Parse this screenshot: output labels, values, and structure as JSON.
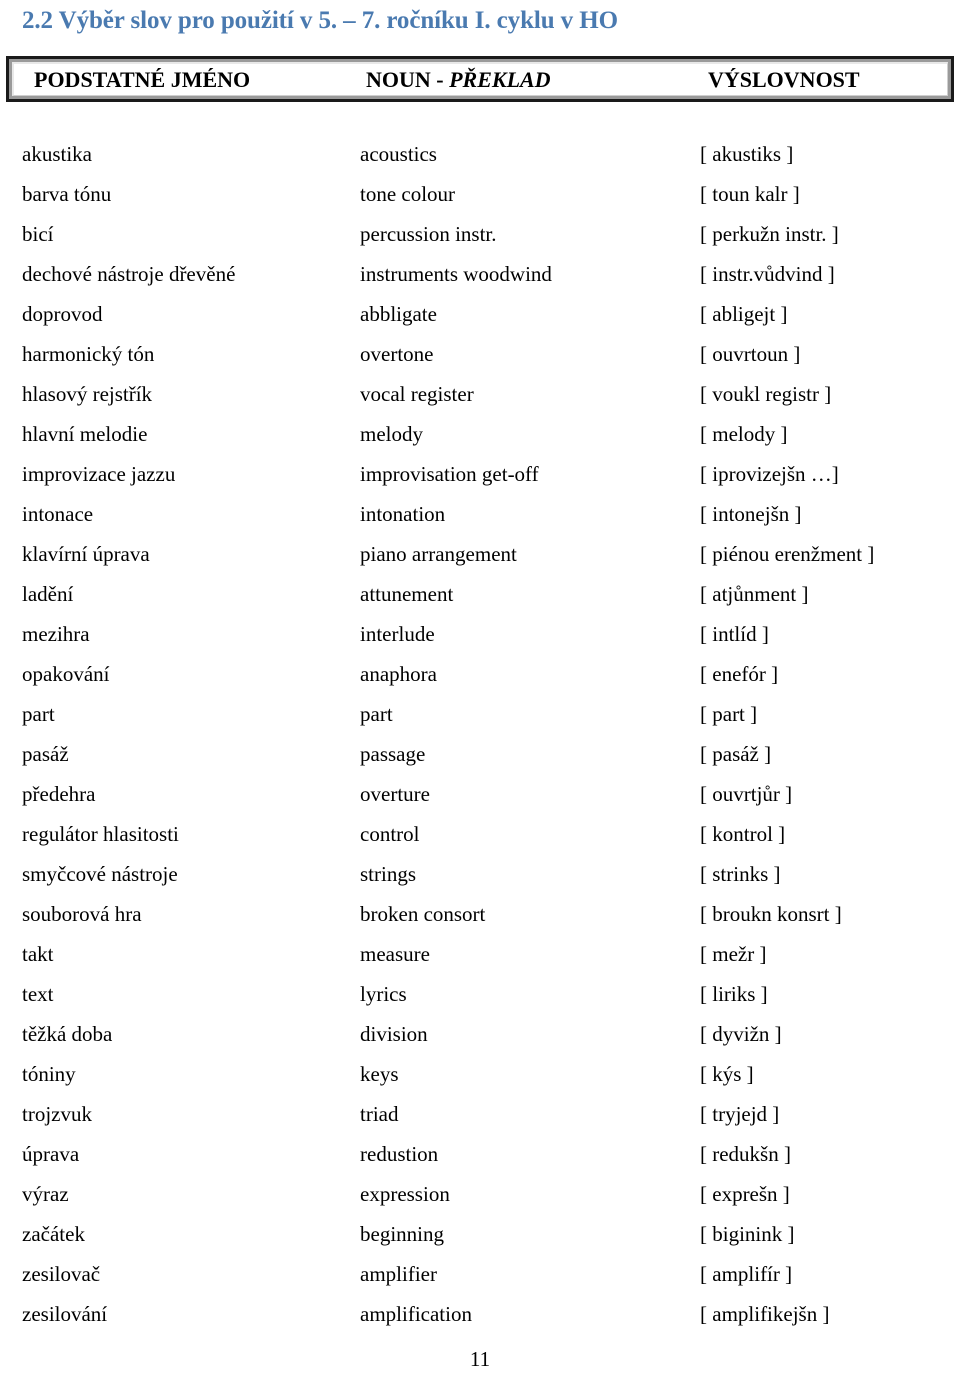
{
  "document": {
    "title": "2.2 Výběr slov pro použití v 5. – 7. ročníku I. cyklu v HO",
    "title_color": "#4a7ab0",
    "page_number": "11"
  },
  "table": {
    "headers": {
      "col1": "PODSTATNÉ JMÉNO",
      "col2_prefix": "NOUN - ",
      "col2_italic": "PŘEKLAD",
      "col3": "VÝSLOVNOST"
    },
    "rows": [
      {
        "cz": "akustika",
        "en": "acoustics",
        "pron": "[ akustiks ]"
      },
      {
        "cz": "barva tónu",
        "en": "tone colour",
        "pron": "[ toun kalr ]"
      },
      {
        "cz": "bicí",
        "en": "percussion instr.",
        "pron": "[ perkužn instr. ]"
      },
      {
        "cz": "dechové nástroje dřevěné",
        "en": "instruments woodwind",
        "pron": "[ instr.vůdvind ]"
      },
      {
        "cz": "doprovod",
        "en": "abbligate",
        "pron": "[ abligejt ]"
      },
      {
        "cz": "harmonický tón",
        "en": "overtone",
        "pron": "[ ouvrtoun ]"
      },
      {
        "cz": "hlasový rejstřík",
        "en": "vocal register",
        "pron": "[ voukl registr ]"
      },
      {
        "cz": "hlavní melodie",
        "en": "melody",
        "pron": "[ melody ]"
      },
      {
        "cz": "improvizace jazzu",
        "en": "improvisation get-off",
        "pron": "[ iprovizejšn …]"
      },
      {
        "cz": "intonace",
        "en": "intonation",
        "pron": "[ intonejšn ]"
      },
      {
        "cz": "klavírní úprava",
        "en": "piano arrangement",
        "pron": "[ piénou erenžment ]"
      },
      {
        "cz": "ladění",
        "en": "attunement",
        "pron": "[ atjůnment ]"
      },
      {
        "cz": "mezihra",
        "en": "interlude",
        "pron": "[ intlíd ]"
      },
      {
        "cz": "opakování",
        "en": "anaphora",
        "pron": "[ enefór ]"
      },
      {
        "cz": "part",
        "en": "part",
        "pron": "[ part ]"
      },
      {
        "cz": "pasáž",
        "en": "passage",
        "pron": "[ pasáž ]"
      },
      {
        "cz": "předehra",
        "en": "overture",
        "pron": "[ ouvrtjůr ]"
      },
      {
        "cz": "regulátor hlasitosti",
        "en": "control",
        "pron": "[ kontrol ]"
      },
      {
        "cz": "smyčcové nástroje",
        "en": "strings",
        "pron": "[ strinks ]"
      },
      {
        "cz": "souborová hra",
        "en": "broken consort",
        "pron": "[ broukn konsrt ]"
      },
      {
        "cz": "takt",
        "en": "measure",
        "pron": "[ mežr ]"
      },
      {
        "cz": "text",
        "en": "lyrics",
        "pron": "[ liriks ]"
      },
      {
        "cz": "těžká doba",
        "en": "division",
        "pron": "[ dyvižn ]"
      },
      {
        "cz": "tóniny",
        "en": "keys",
        "pron": "[ kýs ]"
      },
      {
        "cz": "trojzvuk",
        "en": "triad",
        "pron": "[ tryjejd ]"
      },
      {
        "cz": "úprava",
        "en": "redustion",
        "pron": "[ redukšn ]"
      },
      {
        "cz": "výraz",
        "en": "expression",
        "pron": "[ exprešn ]"
      },
      {
        "cz": "začátek",
        "en": "beginning",
        "pron": "[ biginink ]"
      },
      {
        "cz": "zesilovač",
        "en": "amplifier",
        "pron": "[ amplifír ]"
      },
      {
        "cz": "zesilování",
        "en": "amplification",
        "pron": "[ amplifikejšn ]"
      }
    ]
  }
}
